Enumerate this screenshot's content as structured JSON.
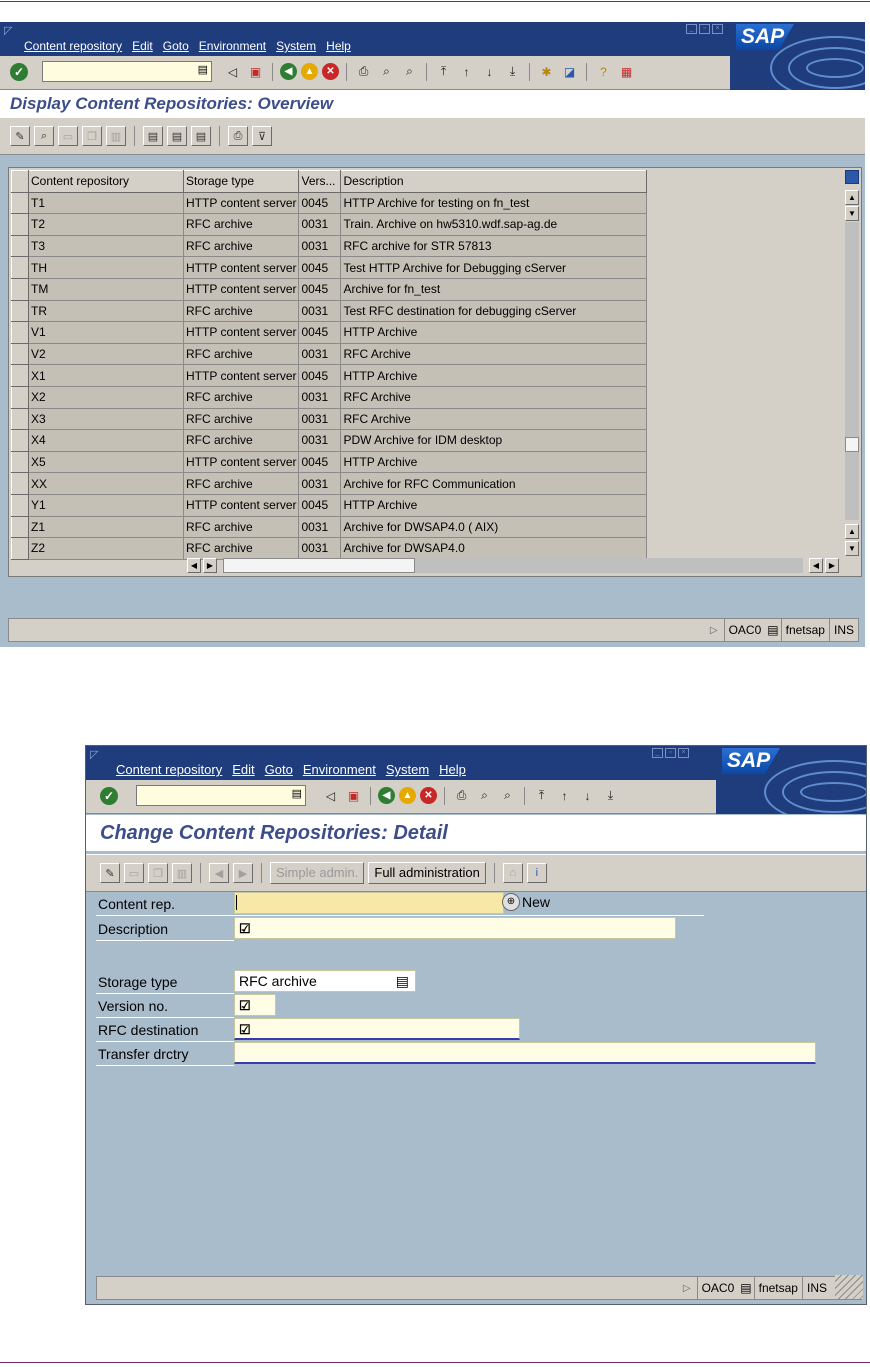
{
  "window1": {
    "menu": [
      "Content repository",
      "Edit",
      "Goto",
      "Environment",
      "System",
      "Help"
    ],
    "logo": "SAP",
    "command_field_value": "",
    "title": "Display Content Repositories: Overview",
    "grid": {
      "headers": [
        "Content repository",
        "Storage type",
        "Vers...",
        "Description"
      ],
      "rows": [
        [
          "T1",
          "HTTP content server",
          "0045",
          "HTTP Archive for testing on fn_test"
        ],
        [
          "T2",
          "RFC archive",
          "0031",
          "Train. Archive on hw5310.wdf.sap-ag.de"
        ],
        [
          "T3",
          "RFC archive",
          "0031",
          "RFC archive for STR 57813"
        ],
        [
          "TH",
          "HTTP content server",
          "0045",
          "Test HTTP Archive for Debugging cServer"
        ],
        [
          "TM",
          "HTTP content server",
          "0045",
          "Archive for fn_test"
        ],
        [
          "TR",
          "RFC archive",
          "0031",
          "Test RFC destination for debugging cServer"
        ],
        [
          "V1",
          "HTTP content server",
          "0045",
          "HTTP Archive"
        ],
        [
          "V2",
          "RFC archive",
          "0031",
          "RFC Archive"
        ],
        [
          "X1",
          "HTTP content server",
          "0045",
          "HTTP Archive"
        ],
        [
          "X2",
          "RFC archive",
          "0031",
          "RFC Archive"
        ],
        [
          "X3",
          "RFC archive",
          "0031",
          "RFC Archive"
        ],
        [
          "X4",
          "RFC archive",
          "0031",
          "PDW Archive for IDM desktop"
        ],
        [
          "X5",
          "HTTP content server",
          "0045",
          "HTTP Archive"
        ],
        [
          "XX",
          "RFC archive",
          "0031",
          "Archive for RFC Communication"
        ],
        [
          "Y1",
          "HTTP content server",
          "0045",
          "HTTP Archive"
        ],
        [
          "Z1",
          "RFC archive",
          "0031",
          "Archive for DWSAP4.0 ( AIX)"
        ],
        [
          "Z2",
          "RFC archive",
          "0031",
          "Archive for DWSAP4.0"
        ]
      ]
    },
    "status": {
      "transaction": "OAC0",
      "server": "fnetsap",
      "mode": "INS"
    }
  },
  "window2": {
    "menu": [
      "Content repository",
      "Edit",
      "Goto",
      "Environment",
      "System",
      "Help"
    ],
    "logo": "SAP",
    "command_field_value": "",
    "title": "Change Content Repositories: Detail",
    "toolbar": {
      "simple_admin": "Simple admin.",
      "full_admin": "Full administration"
    },
    "form": {
      "content_rep": {
        "label": "Content rep.",
        "value": "",
        "new_label": "New"
      },
      "description": {
        "label": "Description",
        "value": "☑"
      },
      "storage_type": {
        "label": "Storage type",
        "value": "RFC archive"
      },
      "version_no": {
        "label": "Version no.",
        "value": "☑"
      },
      "rfc_destination": {
        "label": "RFC destination",
        "value": "☑"
      },
      "transfer_dir": {
        "label": "Transfer drctry",
        "value": ""
      }
    },
    "status": {
      "transaction": "OAC0",
      "server": "fnetsap",
      "mode": "INS"
    }
  },
  "colors": {
    "title_blue": "#3d4d8a",
    "menubar": "#1f3c7c",
    "screen_bg": "#a8bccc",
    "required_field": "#f8e8a8"
  }
}
